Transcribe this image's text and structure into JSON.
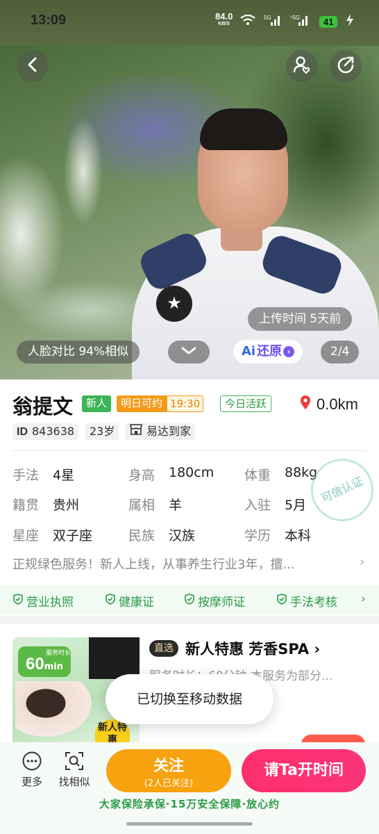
{
  "status_bar": {
    "time": "13:09",
    "net_speed": "84.0",
    "net_unit": "KB/S",
    "battery": "41"
  },
  "hero": {
    "upload_time": "上传时间 5天前",
    "face_match": "人脸对比 94%相似",
    "ai_button": "还原",
    "ai_prefix": "Ai",
    "page_indicator": "2/4"
  },
  "profile": {
    "name": "翁提文",
    "tag_new": "新人",
    "tag_available": "明日可约",
    "tag_available_time": "19:30",
    "tag_active": "今日活跃",
    "distance": "0.0km",
    "id_label": "ID",
    "id_value": "843638",
    "age": "23岁",
    "shop": "易达到家",
    "attributes": [
      {
        "label": "手法",
        "value": "4星"
      },
      {
        "label": "身高",
        "value": "180cm"
      },
      {
        "label": "体重",
        "value": "88kg"
      },
      {
        "label": "籍贯",
        "value": "贵州"
      },
      {
        "label": "属相",
        "value": "羊"
      },
      {
        "label": "入驻",
        "value": "5月"
      },
      {
        "label": "星座",
        "value": "双子座"
      },
      {
        "label": "民族",
        "value": "汉族"
      },
      {
        "label": "学历",
        "value": "本科"
      }
    ],
    "stamp_text": "可信认证",
    "intro": "正规绿色服务！新人上线，从事养生行业3年，擅...",
    "certificates": [
      "营业执照",
      "健康证",
      "按摩师证",
      "手法考核"
    ]
  },
  "service": {
    "badge_minutes": "60",
    "badge_unit": "min",
    "badge_caption": "服务时长",
    "new_badge": "新人特惠",
    "direct_tag": "直选",
    "title": "新人特惠 芳香SPA",
    "desc": "服务时长：60分钟 本服务为部分..."
  },
  "toast": "已切换至移动数据",
  "bottom_bar": {
    "more": "更多",
    "similar": "找相似",
    "follow": "关注",
    "follow_count": "(2人已关注)",
    "book": "请Ta开时间",
    "guarantee": "大家保险承保·15万安全保障·放心约"
  },
  "colors": {
    "green": "#3bb556",
    "orange": "#f39a18",
    "pink": "#ff2f6b",
    "purple": "#6a4df0"
  }
}
